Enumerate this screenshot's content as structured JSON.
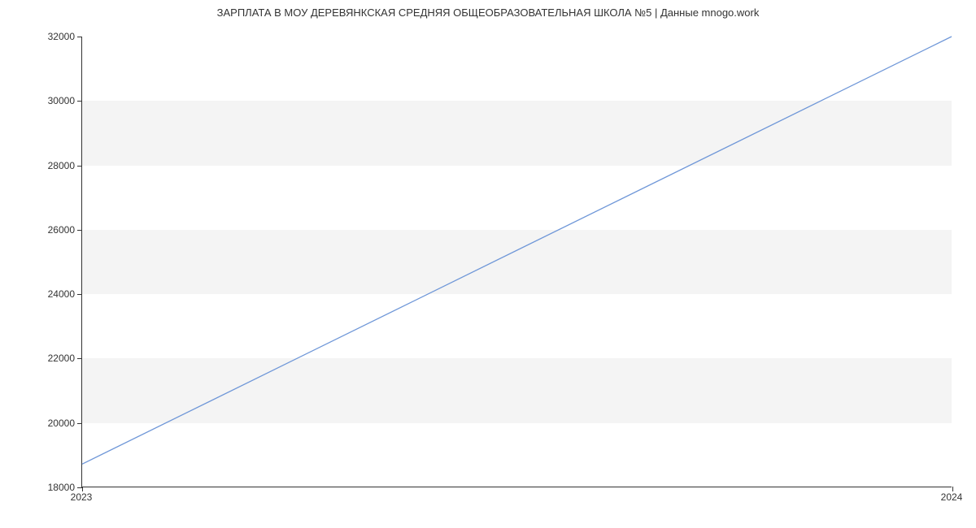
{
  "chart_data": {
    "type": "line",
    "title": "ЗАРПЛАТА В МОУ ДЕРЕВЯНКСКАЯ СРЕДНЯЯ ОБЩЕОБРАЗОВАТЕЛЬНАЯ ШКОЛА №5 | Данные mnogo.work",
    "x": [
      2023,
      2024
    ],
    "values": [
      18700,
      32000
    ],
    "xlabel": "",
    "ylabel": "",
    "xlim": [
      2023,
      2024
    ],
    "ylim": [
      18000,
      32000
    ],
    "y_ticks": [
      18000,
      20000,
      22000,
      24000,
      26000,
      28000,
      30000,
      32000
    ],
    "x_ticks": [
      2023,
      2024
    ],
    "line_color": "#6f97d8"
  }
}
